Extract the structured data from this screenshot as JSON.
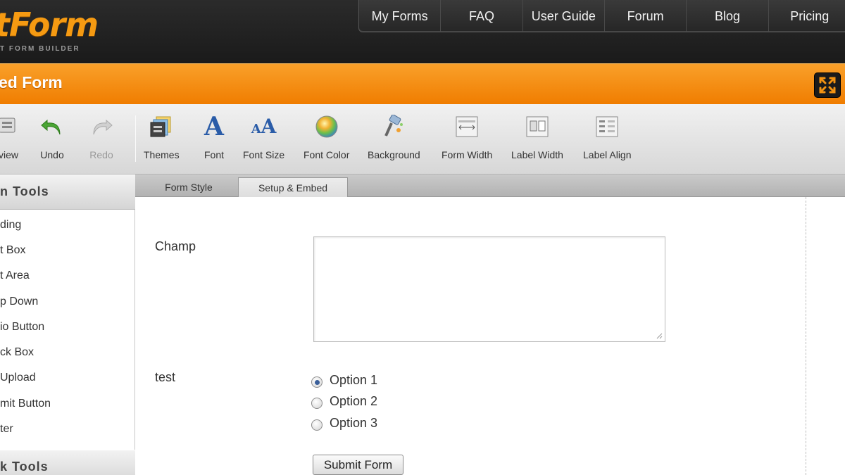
{
  "header": {
    "logo_text": "tForm",
    "logo_tagline": "T FORM BUILDER",
    "nav": [
      "My Forms",
      "FAQ",
      "User Guide",
      "Forum",
      "Blog",
      "Pricing"
    ]
  },
  "titlebar": {
    "title": "ed Form"
  },
  "toolbar": {
    "items": [
      {
        "label": "view",
        "icon": "preview-icon"
      },
      {
        "label": "Undo",
        "icon": "undo-icon"
      },
      {
        "label": "Redo",
        "icon": "redo-icon"
      },
      {
        "label": "Themes",
        "icon": "themes-icon"
      },
      {
        "label": "Font",
        "icon": "font-icon"
      },
      {
        "label": "Font Size",
        "icon": "font-size-icon"
      },
      {
        "label": "Font Color",
        "icon": "font-color-icon"
      },
      {
        "label": "Background",
        "icon": "background-icon"
      },
      {
        "label": "Form Width",
        "icon": "form-width-icon"
      },
      {
        "label": "Label Width",
        "icon": "label-width-icon"
      },
      {
        "label": "Label Align",
        "icon": "label-align-icon"
      }
    ]
  },
  "left_panel": {
    "form_tools_heading": "n Tools",
    "form_tools": [
      "ding",
      "t Box",
      "t Area",
      "p Down",
      "io Button",
      "ck Box",
      "Upload",
      "mit Button",
      "ter"
    ],
    "quick_tools_heading": "k Tools"
  },
  "tabs": {
    "form_style": "Form Style",
    "setup_embed": "Setup & Embed"
  },
  "form": {
    "field1_label": "Champ",
    "field2_label": "test",
    "options": [
      "Option 1",
      "Option 2",
      "Option 3"
    ],
    "selected_option": "Option 1",
    "submit_label": "Submit Form"
  },
  "colors": {
    "accent": "#f28a0e",
    "header_bg": "#222222"
  }
}
